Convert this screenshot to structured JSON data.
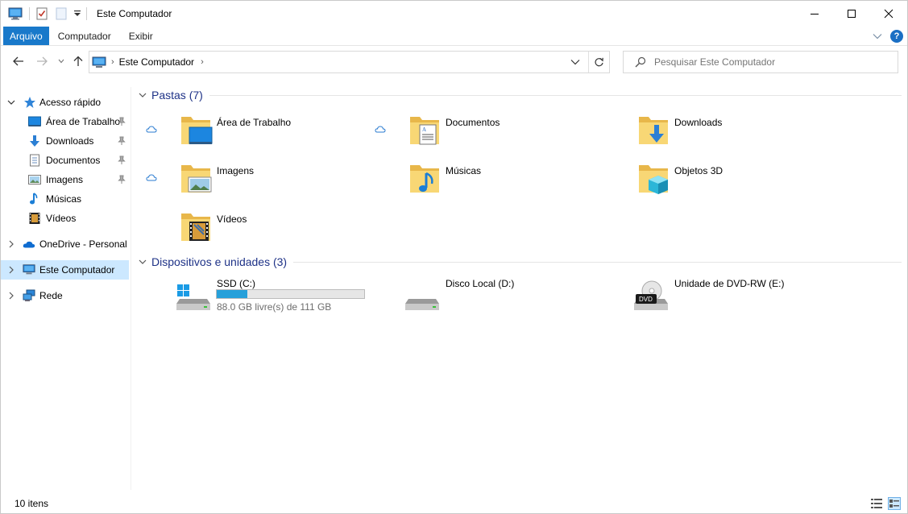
{
  "window": {
    "title": "Este Computador",
    "controls": [
      "minimize",
      "maximize",
      "close"
    ]
  },
  "ribbon": {
    "tabs": [
      {
        "label": "Arquivo",
        "active": true
      },
      {
        "label": "Computador",
        "active": false
      },
      {
        "label": "Exibir",
        "active": false
      }
    ],
    "help": "?"
  },
  "address": {
    "path": "Este Computador",
    "search_placeholder": "Pesquisar Este Computador"
  },
  "sidebar": {
    "items": [
      {
        "label": "Acesso rápido",
        "icon": "star-icon",
        "pinned": false
      },
      {
        "label": "Área de Trabalho",
        "icon": "desktop-icon",
        "pinned": true
      },
      {
        "label": "Downloads",
        "icon": "download-arrow-icon",
        "pinned": true
      },
      {
        "label": "Documentos",
        "icon": "document-icon",
        "pinned": true
      },
      {
        "label": "Imagens",
        "icon": "pictures-icon",
        "pinned": true
      },
      {
        "label": "Músicas",
        "icon": "music-note-icon",
        "pinned": false
      },
      {
        "label": "Vídeos",
        "icon": "film-icon",
        "pinned": false
      },
      {
        "label": "OneDrive - Personal",
        "icon": "onedrive-cloud-icon",
        "pinned": false
      },
      {
        "label": "Este Computador",
        "icon": "computer-icon",
        "pinned": false,
        "selected": true
      },
      {
        "label": "Rede",
        "icon": "network-icon",
        "pinned": false
      }
    ]
  },
  "folders_group": {
    "title": "Pastas (7)",
    "items": [
      {
        "label": "Área de Trabalho",
        "icon": "desktop-folder-icon",
        "cloud": true
      },
      {
        "label": "Documentos",
        "icon": "documents-folder-icon",
        "cloud": true
      },
      {
        "label": "Downloads",
        "icon": "downloads-folder-icon",
        "cloud": false
      },
      {
        "label": "Imagens",
        "icon": "pictures-folder-icon",
        "cloud": true
      },
      {
        "label": "Músicas",
        "icon": "music-folder-icon",
        "cloud": false
      },
      {
        "label": "Objetos 3D",
        "icon": "3d-objects-folder-icon",
        "cloud": false
      },
      {
        "label": "Vídeos",
        "icon": "videos-folder-icon",
        "cloud": false
      }
    ]
  },
  "devices_group": {
    "title": "Dispositivos e unidades (3)",
    "items": [
      {
        "label": "SSD (C:)",
        "icon": "windows-drive-icon",
        "free_text": "88.0 GB livre(s) de 111 GB",
        "used_fraction": 0.21
      },
      {
        "label": "Disco Local (D:)",
        "icon": "hard-drive-icon"
      },
      {
        "label": "Unidade de DVD-RW (E:)",
        "icon": "dvd-drive-icon",
        "badge": "DVD"
      }
    ]
  },
  "status": {
    "items_count": "10 itens"
  },
  "colors": {
    "accent": "#1979ca",
    "selection": "#cce8ff",
    "group_title": "#1e3287",
    "folder": "#f8d775",
    "progress": "#26a0da"
  }
}
